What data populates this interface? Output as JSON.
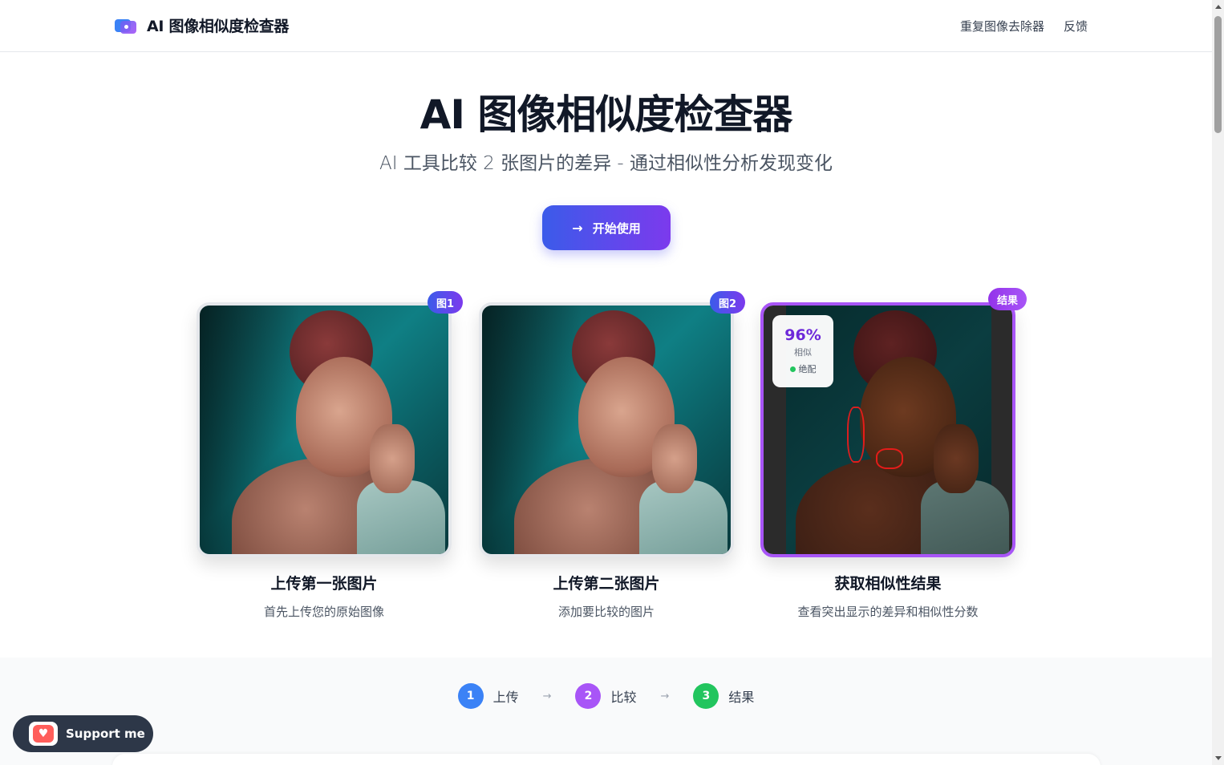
{
  "header": {
    "title": "AI 图像相似度检查器",
    "nav": [
      "重复图像去除器",
      "反馈"
    ]
  },
  "hero": {
    "title": "AI 图像相似度检查器",
    "subtitle": "AI 工具比较 2 张图片的差异 - 通过相似性分析发现变化",
    "cta_label": "开始使用",
    "cta_icon": "arrow-right-icon"
  },
  "cards": [
    {
      "badge": "图1",
      "title": "上传第一张图片",
      "desc": "首先上传您的原始图像"
    },
    {
      "badge": "图2",
      "title": "上传第二张图片",
      "desc": "添加要比较的图片"
    },
    {
      "badge": "结果",
      "title": "获取相似性结果",
      "desc": "查看突出显示的差异和相似性分数"
    }
  ],
  "result_score": {
    "value": "96%",
    "label": "相似",
    "tag": "绝配"
  },
  "steps": [
    {
      "num": "1",
      "label": "上传",
      "color": "#3b82f6"
    },
    {
      "num": "2",
      "label": "比较",
      "color": "#a855f7"
    },
    {
      "num": "3",
      "label": "结果",
      "color": "#22c55e"
    }
  ],
  "support": {
    "label": "Support me"
  },
  "colors": {
    "accent_start": "#3b5bea",
    "accent_end": "#7c3aed",
    "result_border": "#a855f7"
  }
}
